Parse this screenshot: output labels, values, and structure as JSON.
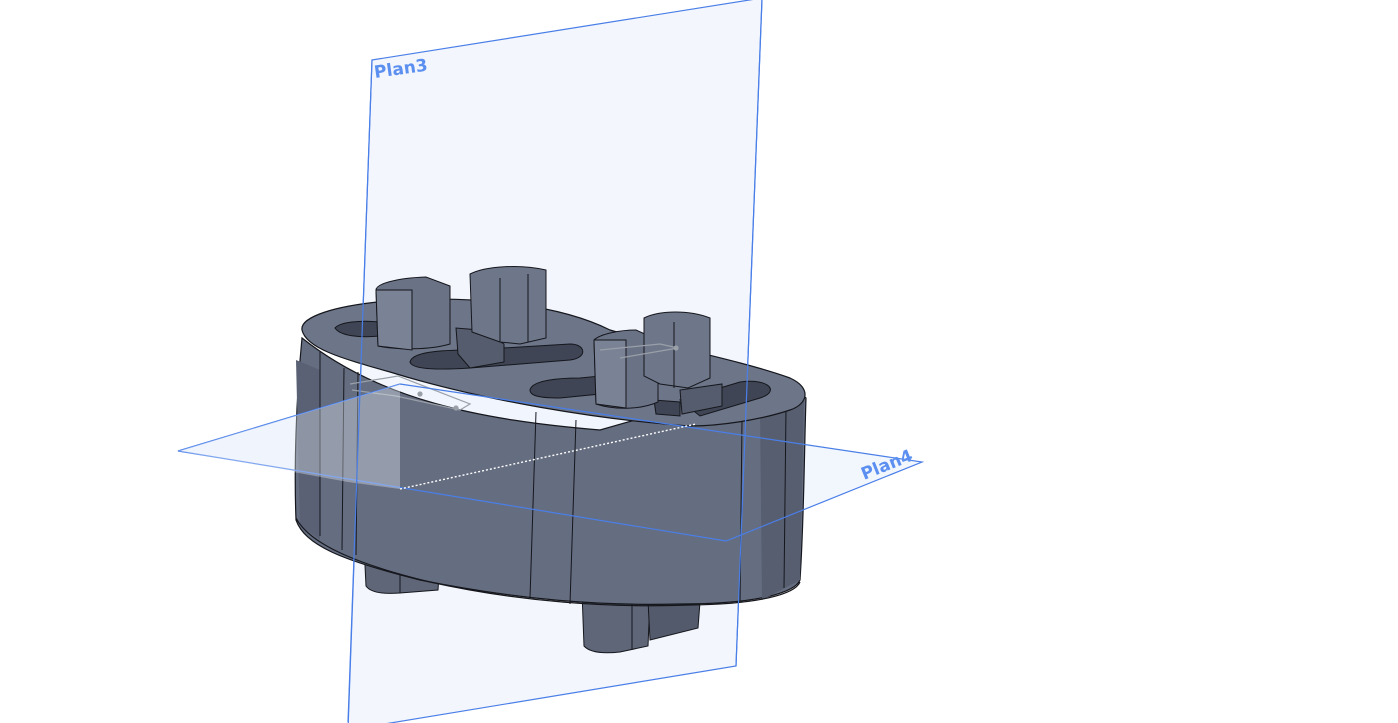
{
  "viewport": {
    "planes": [
      {
        "label": "Plan3"
      },
      {
        "label": "Plan4"
      }
    ]
  },
  "colors": {
    "plane_edge": "#4a7fe8",
    "plane_fill": "#eef3fc",
    "part_body": "#646c80",
    "part_light": "#7a8296",
    "part_dark": "#4a5062",
    "part_edge": "#15171c"
  }
}
